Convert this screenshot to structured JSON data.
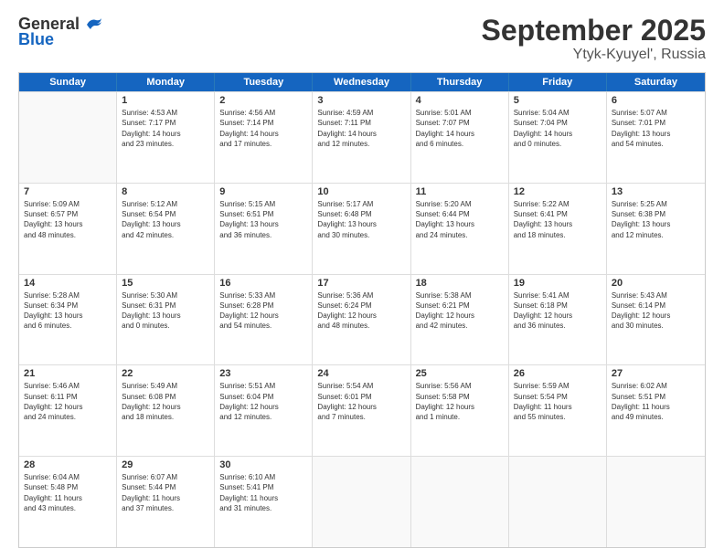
{
  "logo": {
    "general": "General",
    "blue": "Blue"
  },
  "title": "September 2025",
  "subtitle": "Ytyk-Kyuyel', Russia",
  "header_days": [
    "Sunday",
    "Monday",
    "Tuesday",
    "Wednesday",
    "Thursday",
    "Friday",
    "Saturday"
  ],
  "weeks": [
    [
      {
        "day": "",
        "lines": []
      },
      {
        "day": "1",
        "lines": [
          "Sunrise: 4:53 AM",
          "Sunset: 7:17 PM",
          "Daylight: 14 hours",
          "and 23 minutes."
        ]
      },
      {
        "day": "2",
        "lines": [
          "Sunrise: 4:56 AM",
          "Sunset: 7:14 PM",
          "Daylight: 14 hours",
          "and 17 minutes."
        ]
      },
      {
        "day": "3",
        "lines": [
          "Sunrise: 4:59 AM",
          "Sunset: 7:11 PM",
          "Daylight: 14 hours",
          "and 12 minutes."
        ]
      },
      {
        "day": "4",
        "lines": [
          "Sunrise: 5:01 AM",
          "Sunset: 7:07 PM",
          "Daylight: 14 hours",
          "and 6 minutes."
        ]
      },
      {
        "day": "5",
        "lines": [
          "Sunrise: 5:04 AM",
          "Sunset: 7:04 PM",
          "Daylight: 14 hours",
          "and 0 minutes."
        ]
      },
      {
        "day": "6",
        "lines": [
          "Sunrise: 5:07 AM",
          "Sunset: 7:01 PM",
          "Daylight: 13 hours",
          "and 54 minutes."
        ]
      }
    ],
    [
      {
        "day": "7",
        "lines": [
          "Sunrise: 5:09 AM",
          "Sunset: 6:57 PM",
          "Daylight: 13 hours",
          "and 48 minutes."
        ]
      },
      {
        "day": "8",
        "lines": [
          "Sunrise: 5:12 AM",
          "Sunset: 6:54 PM",
          "Daylight: 13 hours",
          "and 42 minutes."
        ]
      },
      {
        "day": "9",
        "lines": [
          "Sunrise: 5:15 AM",
          "Sunset: 6:51 PM",
          "Daylight: 13 hours",
          "and 36 minutes."
        ]
      },
      {
        "day": "10",
        "lines": [
          "Sunrise: 5:17 AM",
          "Sunset: 6:48 PM",
          "Daylight: 13 hours",
          "and 30 minutes."
        ]
      },
      {
        "day": "11",
        "lines": [
          "Sunrise: 5:20 AM",
          "Sunset: 6:44 PM",
          "Daylight: 13 hours",
          "and 24 minutes."
        ]
      },
      {
        "day": "12",
        "lines": [
          "Sunrise: 5:22 AM",
          "Sunset: 6:41 PM",
          "Daylight: 13 hours",
          "and 18 minutes."
        ]
      },
      {
        "day": "13",
        "lines": [
          "Sunrise: 5:25 AM",
          "Sunset: 6:38 PM",
          "Daylight: 13 hours",
          "and 12 minutes."
        ]
      }
    ],
    [
      {
        "day": "14",
        "lines": [
          "Sunrise: 5:28 AM",
          "Sunset: 6:34 PM",
          "Daylight: 13 hours",
          "and 6 minutes."
        ]
      },
      {
        "day": "15",
        "lines": [
          "Sunrise: 5:30 AM",
          "Sunset: 6:31 PM",
          "Daylight: 13 hours",
          "and 0 minutes."
        ]
      },
      {
        "day": "16",
        "lines": [
          "Sunrise: 5:33 AM",
          "Sunset: 6:28 PM",
          "Daylight: 12 hours",
          "and 54 minutes."
        ]
      },
      {
        "day": "17",
        "lines": [
          "Sunrise: 5:36 AM",
          "Sunset: 6:24 PM",
          "Daylight: 12 hours",
          "and 48 minutes."
        ]
      },
      {
        "day": "18",
        "lines": [
          "Sunrise: 5:38 AM",
          "Sunset: 6:21 PM",
          "Daylight: 12 hours",
          "and 42 minutes."
        ]
      },
      {
        "day": "19",
        "lines": [
          "Sunrise: 5:41 AM",
          "Sunset: 6:18 PM",
          "Daylight: 12 hours",
          "and 36 minutes."
        ]
      },
      {
        "day": "20",
        "lines": [
          "Sunrise: 5:43 AM",
          "Sunset: 6:14 PM",
          "Daylight: 12 hours",
          "and 30 minutes."
        ]
      }
    ],
    [
      {
        "day": "21",
        "lines": [
          "Sunrise: 5:46 AM",
          "Sunset: 6:11 PM",
          "Daylight: 12 hours",
          "and 24 minutes."
        ]
      },
      {
        "day": "22",
        "lines": [
          "Sunrise: 5:49 AM",
          "Sunset: 6:08 PM",
          "Daylight: 12 hours",
          "and 18 minutes."
        ]
      },
      {
        "day": "23",
        "lines": [
          "Sunrise: 5:51 AM",
          "Sunset: 6:04 PM",
          "Daylight: 12 hours",
          "and 12 minutes."
        ]
      },
      {
        "day": "24",
        "lines": [
          "Sunrise: 5:54 AM",
          "Sunset: 6:01 PM",
          "Daylight: 12 hours",
          "and 7 minutes."
        ]
      },
      {
        "day": "25",
        "lines": [
          "Sunrise: 5:56 AM",
          "Sunset: 5:58 PM",
          "Daylight: 12 hours",
          "and 1 minute."
        ]
      },
      {
        "day": "26",
        "lines": [
          "Sunrise: 5:59 AM",
          "Sunset: 5:54 PM",
          "Daylight: 11 hours",
          "and 55 minutes."
        ]
      },
      {
        "day": "27",
        "lines": [
          "Sunrise: 6:02 AM",
          "Sunset: 5:51 PM",
          "Daylight: 11 hours",
          "and 49 minutes."
        ]
      }
    ],
    [
      {
        "day": "28",
        "lines": [
          "Sunrise: 6:04 AM",
          "Sunset: 5:48 PM",
          "Daylight: 11 hours",
          "and 43 minutes."
        ]
      },
      {
        "day": "29",
        "lines": [
          "Sunrise: 6:07 AM",
          "Sunset: 5:44 PM",
          "Daylight: 11 hours",
          "and 37 minutes."
        ]
      },
      {
        "day": "30",
        "lines": [
          "Sunrise: 6:10 AM",
          "Sunset: 5:41 PM",
          "Daylight: 11 hours",
          "and 31 minutes."
        ]
      },
      {
        "day": "",
        "lines": []
      },
      {
        "day": "",
        "lines": []
      },
      {
        "day": "",
        "lines": []
      },
      {
        "day": "",
        "lines": []
      }
    ]
  ]
}
